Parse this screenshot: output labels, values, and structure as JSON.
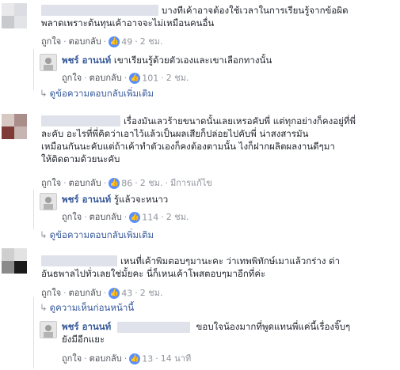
{
  "comments": [
    {
      "text_lines": [
        "บางทีเค้าอาจต้องใช้เวลาในการเรียนรู้จากข้อผิด",
        "พลาดเพราะต้นทุนเค้าอาจจะไม่เหมือนคนอื่น"
      ],
      "like_label": "ถูกใจ",
      "reply_label": "ตอบกลับ",
      "like_count": "49",
      "time": "2 ชม."
    },
    {
      "text_lines": [
        "เรื่องมันเลวร้ายขนาดนั้นเลยเหรอคับพี่ แต่ทุกอย่างก็คงอยู่ที่พี่",
        "ละคับ อะไรที่พี่คิดว่าเอาไว้แล้วเป็นผลเสียก็ปล่อยไปคับพี่ น่าสงสารมัน",
        "เหมือนกันนะคับแต่ถ้าเค้าทำตัวเองก็คงต้องตามนั้น ไงก็ฝากผลิตผลงานดีๆมา",
        "ให้ติดตามด้วยนะคับ"
      ],
      "like_label": "ถูกใจ",
      "reply_label": "ตอบกลับ",
      "like_count": "86",
      "time": "2 ชม.",
      "edited": "มีการแก้ไข"
    },
    {
      "text_lines": [
        "เหนที่เค้าพิมตอบๆมานะคะ ว่าเทพพิทักษ์เมาแล้วกร่าง ด่า",
        "อันธพาลไปทั่วเลยใช่มั้ยคะ นี่ก็เหนเค้าโพสตอบๆมาอีกที่ค่ะ"
      ],
      "like_label": "ถูกใจ",
      "reply_label": "ตอบกลับ",
      "like_count": "43",
      "time": "2 ชม."
    }
  ],
  "replies": [
    {
      "author": "พชร์ อานนท์",
      "text_lines": [
        "เขาเรียนรู้ด้วยตัวเองและเขาเลือกทางนั้น"
      ],
      "like_label": "ถูกใจ",
      "reply_label": "ตอบกลับ",
      "like_count": "101",
      "time": "2 ชม."
    },
    {
      "author": "พชร์ อานนท์",
      "text_lines": [
        "รู้แล้วจะหนาว"
      ],
      "like_label": "ถูกใจ",
      "reply_label": "ตอบกลับ",
      "like_count": "114",
      "time": "2 ชม."
    },
    {
      "author": "พชร์ อานนท์",
      "text_lines": [
        "ขอบใจน้องมากที่พูดแทนพี่แค่นี้เรื่องจิ๊บๆ",
        "ยังมีอีกแยะ"
      ],
      "like_label": "ถูกใจ",
      "reply_label": "ตอบกลับ",
      "like_count": "13",
      "time": "14 นาที"
    }
  ],
  "links": {
    "more_replies_1": "ดูข้อความตอบกลับเพิ่มเติม",
    "more_replies_2": "ดูข้อความตอบกลับเพิ่มเติม",
    "previous_comments": "ดูความเห็นก่อนหน้านี้"
  },
  "colors": {
    "link": "#365899",
    "meta": "#90949c",
    "like_badge": "#5890ff"
  },
  "icons": {
    "like": "thumbs-up-icon",
    "expand": "reply-arrow-icon"
  }
}
